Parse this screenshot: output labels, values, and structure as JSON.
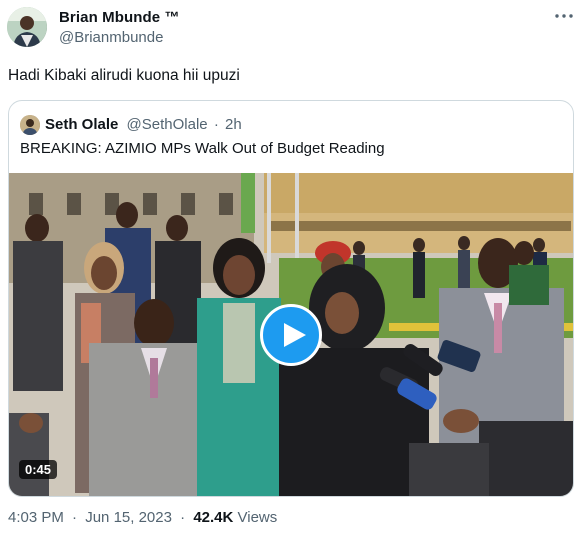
{
  "author": {
    "name": "Brian Mbunde ™",
    "handle": "@Brianmbunde"
  },
  "tweet": {
    "text": "Hadi Kibaki alirudi kuona hii upuzi"
  },
  "quoted_tweet": {
    "name": "Seth Olale",
    "handle": "@SethOlale",
    "separator": "·",
    "time": "2h",
    "text": "BREAKING: AZIMIO MPs Walk Out of Budget Reading",
    "video": {
      "duration": "0:45"
    }
  },
  "meta": {
    "time": "4:03 PM",
    "separator": "·",
    "date": "Jun 15, 2023",
    "separator2": "·",
    "views_count": "42.4K",
    "views_label": "Views"
  },
  "colors": {
    "accent": "#1d9bf0",
    "secondary_text": "#536471",
    "border": "#cfd9de"
  },
  "icons": {
    "more": "more-horizontal-icon",
    "play": "play-icon"
  }
}
